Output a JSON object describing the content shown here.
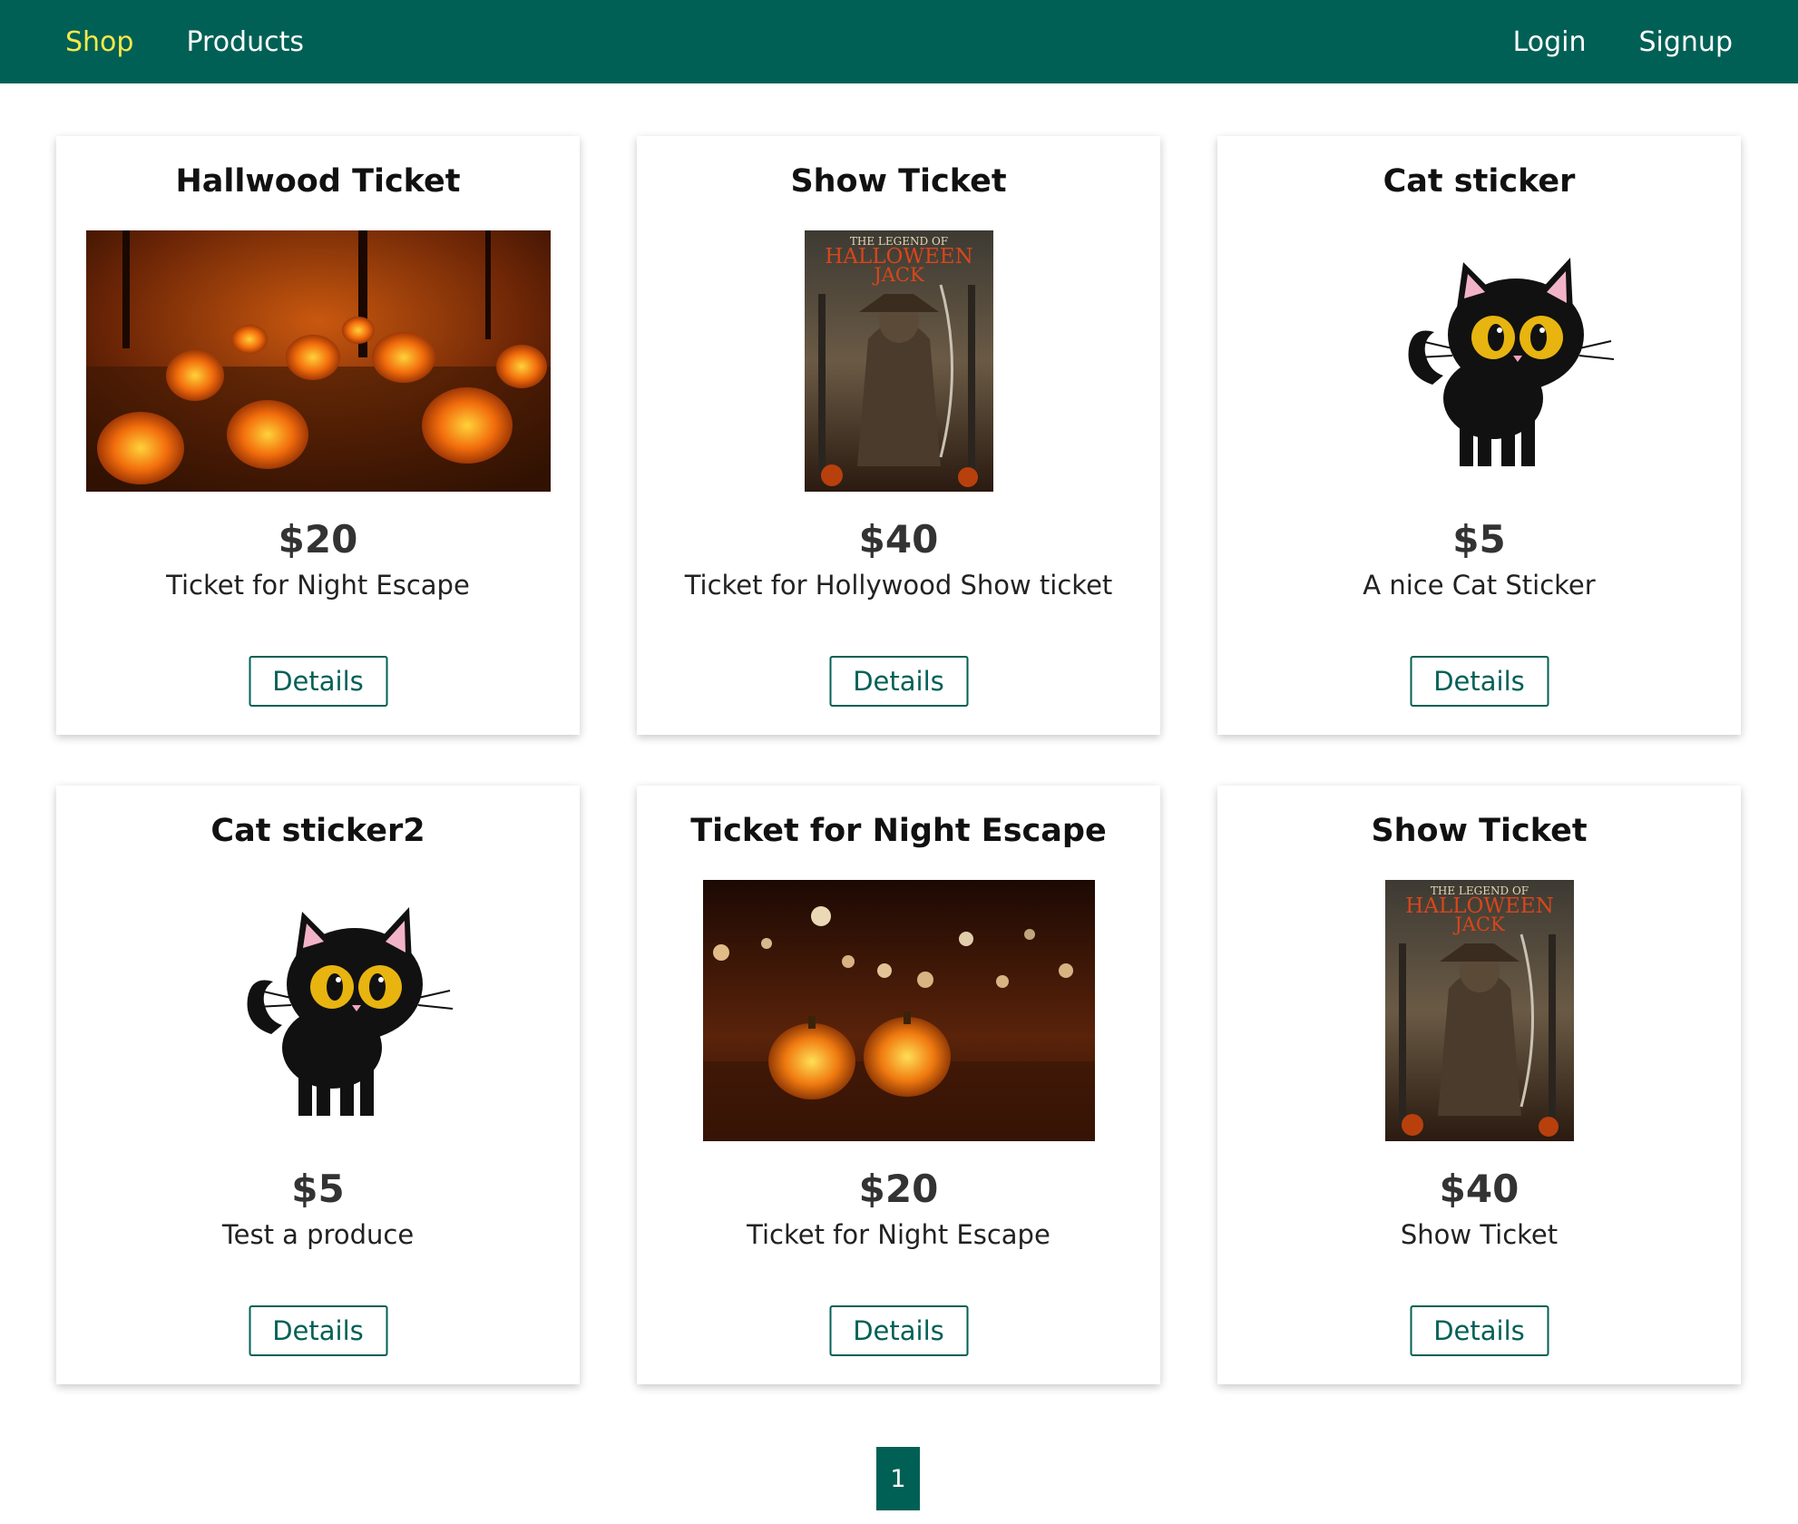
{
  "nav": {
    "brand": "Shop",
    "products": "Products",
    "login": "Login",
    "signup": "Signup"
  },
  "products": [
    {
      "title": "Hallwood Ticket",
      "price": "$20",
      "description": "Ticket for Night Escape",
      "button": "Details",
      "image": "pumpkin-field-image"
    },
    {
      "title": "Show Ticket",
      "price": "$40",
      "description": "Ticket for Hollywood Show ticket",
      "button": "Details",
      "image": "halloween-jack-poster",
      "poster_lines": [
        "THE LEGEND OF",
        "HALLOWEEN",
        "JACK"
      ]
    },
    {
      "title": "Cat sticker",
      "price": "$5",
      "description": "A nice Cat Sticker",
      "button": "Details",
      "image": "black-cat-image"
    },
    {
      "title": "Cat sticker2",
      "price": "$5",
      "description": "Test a produce",
      "button": "Details",
      "image": "black-cat-image"
    },
    {
      "title": "Ticket for Night Escape",
      "price": "$20",
      "description": "Ticket for Night Escape",
      "button": "Details",
      "image": "pumpkins-bokeh-image"
    },
    {
      "title": "Show Ticket",
      "price": "$40",
      "description": "Show Ticket",
      "button": "Details",
      "image": "halloween-jack-poster",
      "poster_lines": [
        "THE LEGEND OF",
        "HALLOWEEN",
        "JACK"
      ]
    }
  ],
  "pagination": {
    "current_page": "1"
  },
  "colors": {
    "primary": "#016055",
    "brand_accent": "#f5e94a"
  }
}
